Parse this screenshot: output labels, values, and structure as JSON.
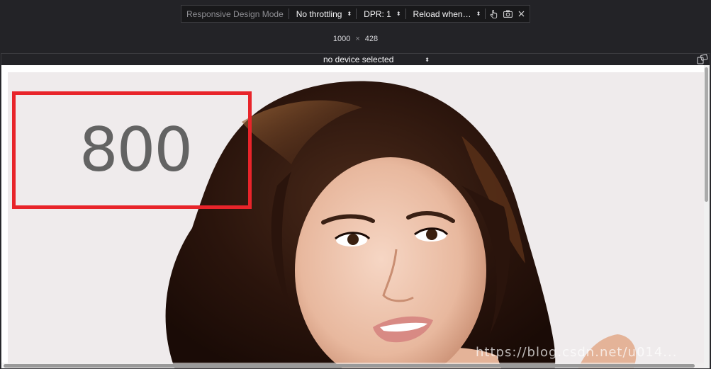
{
  "toolbar": {
    "title": "Responsive Design Mode",
    "throttling": "No throttling",
    "dpr": "DPR: 1",
    "reload": "Reload when…",
    "icons": [
      "touch-icon",
      "screenshot-icon",
      "close-icon"
    ]
  },
  "viewport": {
    "width": "1000",
    "separator": "×",
    "height": "428"
  },
  "device": {
    "selected": "no device selected"
  },
  "content": {
    "annotation_number": "800",
    "annotation_color": "#e8242a",
    "watermark": "https://blog.csdn.net/u014..."
  },
  "colors": {
    "toolbar_bg": "#18181a",
    "chrome_bg": "#232327"
  }
}
